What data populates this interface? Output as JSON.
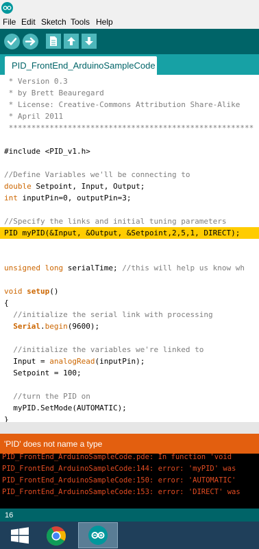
{
  "menu": [
    "File",
    "Edit",
    "Sketch",
    "Tools",
    "Help"
  ],
  "toolbar": {
    "verify": "check-icon",
    "upload": "arrow-right-icon",
    "new": "new-file-icon",
    "open": "arrow-up-icon",
    "save": "arrow-down-icon"
  },
  "tab": {
    "label": "PID_FrontEnd_ArduinoSampleCode"
  },
  "code": [
    {
      "seg": [
        {
          "t": " * Version 0.3",
          "c": "cm"
        }
      ]
    },
    {
      "seg": [
        {
          "t": " * by Brett Beauregard",
          "c": "cm"
        }
      ]
    },
    {
      "seg": [
        {
          "t": " * License: Creative-Commons Attribution Share-Alike",
          "c": "cm"
        }
      ]
    },
    {
      "seg": [
        {
          "t": " * April 2011",
          "c": "cm"
        }
      ]
    },
    {
      "seg": [
        {
          "t": " ******************************************************",
          "c": "cm"
        }
      ]
    },
    {
      "seg": []
    },
    {
      "seg": [
        {
          "t": "#include <PID_v1.h>",
          "c": ""
        }
      ]
    },
    {
      "seg": []
    },
    {
      "seg": [
        {
          "t": "//Define Variables we'll be connecting to",
          "c": "cm"
        }
      ]
    },
    {
      "seg": [
        {
          "t": "double",
          "c": "kw"
        },
        {
          "t": " Setpoint, Input, Output;",
          "c": ""
        }
      ]
    },
    {
      "seg": [
        {
          "t": "int",
          "c": "kw"
        },
        {
          "t": " inputPin=0, outputPin=3;",
          "c": ""
        }
      ]
    },
    {
      "seg": []
    },
    {
      "seg": [
        {
          "t": "//Specify the links and initial tuning parameters",
          "c": "cm"
        }
      ]
    },
    {
      "hl": true,
      "seg": [
        {
          "t": "PID myPID(&Input, &Output, &Setpoint,2,5,1, DIRECT);",
          "c": ""
        }
      ]
    },
    {
      "seg": []
    },
    {
      "seg": []
    },
    {
      "seg": [
        {
          "t": "unsigned long",
          "c": "kw"
        },
        {
          "t": " serialTime; ",
          "c": ""
        },
        {
          "t": "//this will help us know wh",
          "c": "cm"
        }
      ]
    },
    {
      "seg": []
    },
    {
      "seg": [
        {
          "t": "void",
          "c": "kw"
        },
        {
          "t": " ",
          "c": ""
        },
        {
          "t": "setup",
          "c": "bold"
        },
        {
          "t": "()",
          "c": ""
        }
      ]
    },
    {
      "seg": [
        {
          "t": "{",
          "c": ""
        }
      ]
    },
    {
      "seg": [
        {
          "t": "  //initialize the serial link with processing",
          "c": "cm"
        }
      ]
    },
    {
      "seg": [
        {
          "t": "  ",
          "c": ""
        },
        {
          "t": "Serial",
          "c": "bold"
        },
        {
          "t": ".",
          "c": ""
        },
        {
          "t": "begin",
          "c": "kw"
        },
        {
          "t": "(9600);",
          "c": ""
        }
      ]
    },
    {
      "seg": []
    },
    {
      "seg": [
        {
          "t": "  //initialize the variables we're linked to",
          "c": "cm"
        }
      ]
    },
    {
      "seg": [
        {
          "t": "  Input = ",
          "c": ""
        },
        {
          "t": "analogRead",
          "c": "kw"
        },
        {
          "t": "(inputPin);",
          "c": ""
        }
      ]
    },
    {
      "seg": [
        {
          "t": "  Setpoint = 100;",
          "c": ""
        }
      ]
    },
    {
      "seg": []
    },
    {
      "seg": [
        {
          "t": "  //turn the PID on",
          "c": "cm"
        }
      ]
    },
    {
      "seg": [
        {
          "t": "  myPID.SetMode(AUTOMATIC);",
          "c": ""
        }
      ]
    },
    {
      "seg": [
        {
          "t": "}",
          "c": ""
        }
      ]
    }
  ],
  "status": {
    "message": "'PID' does not name a type"
  },
  "console": [
    "PID_FrontEnd_ArduinoSampleCode.pde: In function 'void",
    "PID_FrontEnd_ArduinoSampleCode:144: error: 'myPID' was",
    "PID_FrontEnd_ArduinoSampleCode:150: error: 'AUTOMATIC'",
    "PID_FrontEnd_ArduinoSampleCode:153: error: 'DIRECT' was"
  ],
  "line_number": "16",
  "taskbar": {
    "start": "windows-logo-icon",
    "apps": [
      "chrome-icon",
      "arduino-icon"
    ]
  }
}
